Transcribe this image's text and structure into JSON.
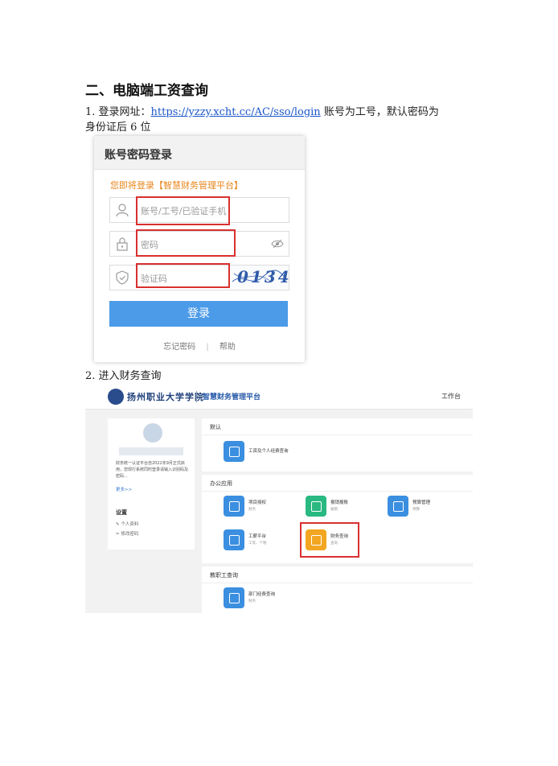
{
  "heading": "二、电脑端工资查询",
  "step1": {
    "prefix": "1. 登录网址：",
    "url": "https://yzzy.xcht.cc/AC/sso/login",
    "suffix_line1": " 账号为工号，默认密码为",
    "line2": "身份证后 6 位"
  },
  "login": {
    "title": "账号密码登录",
    "subtitle": "您即将登录【智慧财务管理平台】",
    "username_placeholder": "账号/工号/已验证手机",
    "password_placeholder": "密码",
    "captcha_placeholder": "验证码",
    "captcha_image_text": "0134",
    "login_button": "登录",
    "forgot_password": "忘记密码",
    "separator": "|",
    "help": "帮助",
    "icons": {
      "user": "user-icon",
      "lock": "lock-icon",
      "shield": "shield-icon",
      "eye": "eye-icon"
    },
    "colors": {
      "button": "#4c9be8",
      "highlight": "#d9302f",
      "subtitle": "#e8841a"
    }
  },
  "step2": "2. 进入财务查询",
  "portal": {
    "school_logo_text": "扬州职业大学学院",
    "platform_name": "智慧财务管理平台",
    "workbench": "工作台",
    "user_card": {
      "notice": "财务统一认证平台自2022年9月正式启用，您现行系统同时登录请输入识别码及密码...",
      "more": "更多>>",
      "settings_title": "设置",
      "personal_info": "个人资料",
      "change_password": "修改密码"
    },
    "default_section": {
      "title": "默认",
      "apps": [
        {
          "name": "工资及个人经费查询",
          "sub": ""
        }
      ]
    },
    "office_section": {
      "title": "办公应用",
      "apps": [
        {
          "name": "项目授权",
          "sub": "财务",
          "color": "#3b8fe0"
        },
        {
          "name": "报销报账",
          "sub": "报销",
          "color": "#29b981"
        },
        {
          "name": "预算管理",
          "sub": "预算",
          "color": "#3b8fe0"
        },
        {
          "name": "工薪平台",
          "sub": "工资、个税",
          "color": "#3b8fe0"
        },
        {
          "name": "财务查询",
          "sub": "查询",
          "color": "#f2a622"
        }
      ]
    },
    "staff_section": {
      "title": "教职工查询",
      "apps": [
        {
          "name": "部门经费查询",
          "sub": "财务"
        }
      ]
    }
  }
}
